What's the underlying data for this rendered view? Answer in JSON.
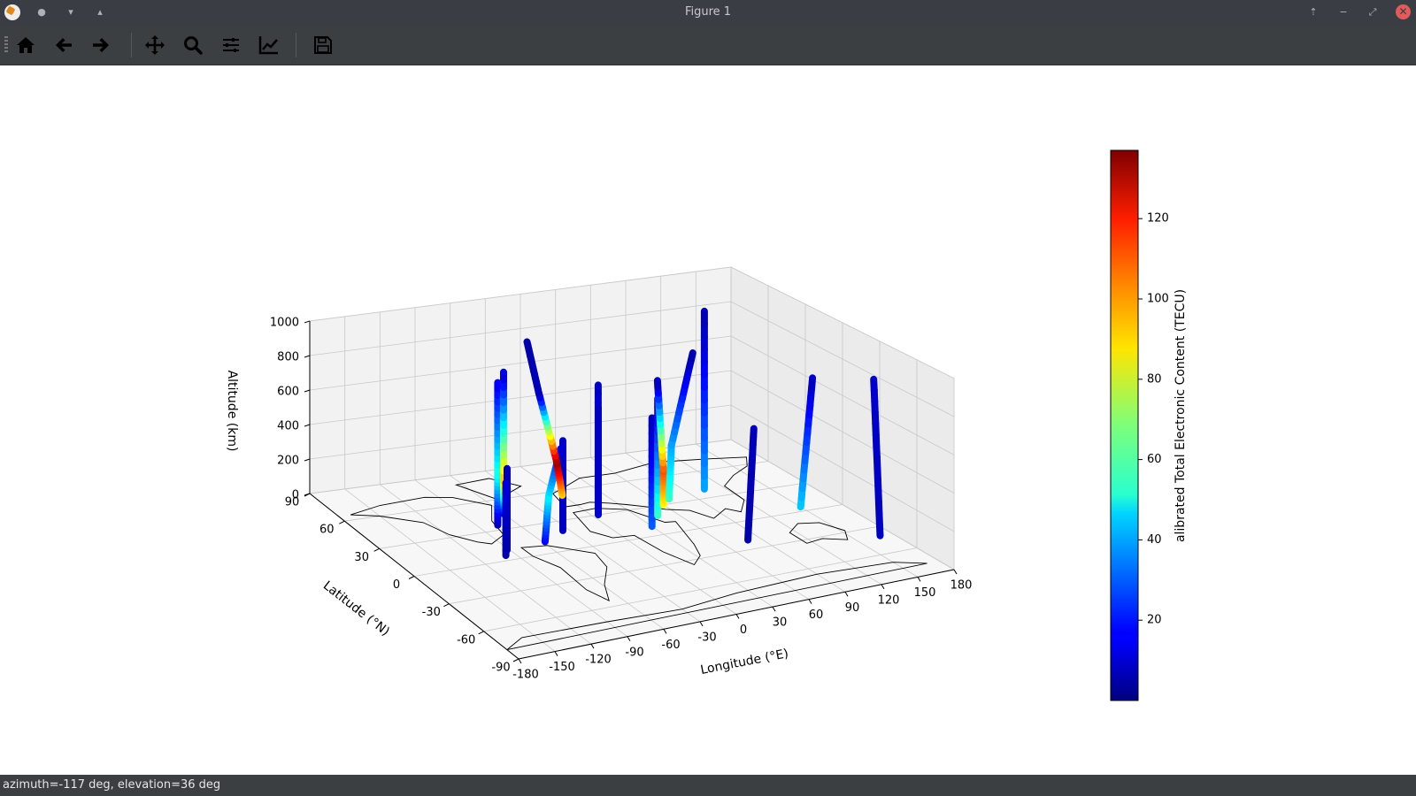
{
  "window": {
    "title": "Figure 1",
    "controls": {
      "dot": "●",
      "down": "▾",
      "up": "▴",
      "pin": "⇡",
      "minimize": "−",
      "restore": "⤢",
      "close": "✕"
    }
  },
  "toolbar": {
    "items": [
      "home-icon",
      "back-arrow-icon",
      "forward-arrow-icon",
      "pan-icon",
      "zoom-icon",
      "subplots-icon",
      "customize-icon",
      "save-icon"
    ]
  },
  "status": {
    "text": "azimuth=-117 deg, elevation=36 deg"
  },
  "chart_data": {
    "type": "scatter",
    "colormap": "jet",
    "xlabel": "Longitude (°E)",
    "ylabel": "Latitude (°N)",
    "zlabel": "Altitude (km)",
    "colorbar_label": "alibrated Total Electronic Content (TECU)",
    "xlim": [
      -180,
      180
    ],
    "ylim": [
      -90,
      90
    ],
    "zlim": [
      0,
      1000
    ],
    "xticks": [
      "-180",
      "-150",
      "-120",
      "-90",
      "-60",
      "-30",
      "0",
      "30",
      "60",
      "90",
      "120",
      "150",
      "180"
    ],
    "yticks": [
      "-90",
      "-60",
      "-30",
      "0",
      "30",
      "60",
      "90"
    ],
    "zticks": [
      "0",
      "200",
      "400",
      "600",
      "800",
      "1000"
    ],
    "colorbar_range": [
      0,
      137
    ],
    "colorbar_ticks": [
      "20",
      "40",
      "60",
      "80",
      "100",
      "120"
    ],
    "view": {
      "azimuth": -117,
      "elevation": 36
    },
    "series": [
      {
        "points": [
          {
            "lon": -75,
            "lat": 35,
            "alt": 0,
            "tec": 5
          },
          {
            "lon": -75,
            "lat": 35,
            "alt": 300,
            "tec": 55
          },
          {
            "lon": -75,
            "lat": 35,
            "alt": 800,
            "tec": 15
          }
        ]
      },
      {
        "points": [
          {
            "lon": -60,
            "lat": 45,
            "alt": 0,
            "tec": 10
          },
          {
            "lon": -60,
            "lat": 45,
            "alt": 200,
            "tec": 95
          },
          {
            "lon": -60,
            "lat": 45,
            "alt": 800,
            "tec": 10
          }
        ]
      },
      {
        "points": [
          {
            "lon": -92,
            "lat": 10,
            "alt": 0,
            "tec": 5
          },
          {
            "lon": -92,
            "lat": 10,
            "alt": 450,
            "tec": 8
          }
        ]
      },
      {
        "points": [
          {
            "lon": -98,
            "lat": 5,
            "alt": 0,
            "tec": 5
          },
          {
            "lon": -98,
            "lat": 5,
            "alt": 400,
            "tec": 12
          }
        ]
      },
      {
        "points": [
          {
            "lon": -58,
            "lat": 12,
            "alt": 0,
            "tec": 15
          },
          {
            "lon": -55,
            "lat": 12,
            "alt": 250,
            "tec": 50
          },
          {
            "lon": -45,
            "lat": 12,
            "alt": 500,
            "tec": 15
          }
        ]
      },
      {
        "points": [
          {
            "lon": -35,
            "lat": 20,
            "alt": 0,
            "tec": 8
          },
          {
            "lon": -35,
            "lat": 20,
            "alt": 500,
            "tec": 10
          }
        ]
      },
      {
        "points": [
          {
            "lon": 10,
            "lat": 35,
            "alt": 0,
            "tec": 30
          },
          {
            "lon": 10,
            "lat": 35,
            "alt": 700,
            "tec": 8
          }
        ]
      },
      {
        "points": [
          {
            "lon": 0,
            "lat": 55,
            "alt": 0,
            "tec": 90
          },
          {
            "lon": -5,
            "lat": 55,
            "alt": 200,
            "tec": 135
          },
          {
            "lon": -20,
            "lat": 55,
            "alt": 600,
            "tec": 8
          },
          {
            "lon": -30,
            "lat": 55,
            "alt": 900,
            "tec": 5
          }
        ]
      },
      {
        "points": [
          {
            "lon": 5,
            "lat": 30,
            "alt": 0,
            "tec": 10
          },
          {
            "lon": 5,
            "lat": 30,
            "alt": 600,
            "tec": 8
          }
        ]
      },
      {
        "points": [
          {
            "lon": 30,
            "lat": 10,
            "alt": 0,
            "tec": 30
          },
          {
            "lon": 30,
            "lat": 10,
            "alt": 600,
            "tec": 8
          }
        ]
      },
      {
        "points": [
          {
            "lon": 45,
            "lat": 20,
            "alt": 0,
            "tec": 60
          },
          {
            "lon": 45,
            "lat": 20,
            "alt": 650,
            "tec": 10
          }
        ]
      },
      {
        "points": [
          {
            "lon": 60,
            "lat": 30,
            "alt": 0,
            "tec": 85
          },
          {
            "lon": 60,
            "lat": 30,
            "alt": 200,
            "tec": 110
          },
          {
            "lon": 55,
            "lat": 30,
            "alt": 700,
            "tec": 5
          }
        ]
      },
      {
        "points": [
          {
            "lon": 70,
            "lat": 35,
            "alt": 0,
            "tec": 60
          },
          {
            "lon": 72,
            "lat": 35,
            "alt": 300,
            "tec": 40
          },
          {
            "lon": 90,
            "lat": 35,
            "alt": 800,
            "tec": 5
          }
        ]
      },
      {
        "points": [
          {
            "lon": 105,
            "lat": 40,
            "alt": 0,
            "tec": 40
          },
          {
            "lon": 105,
            "lat": 40,
            "alt": 1000,
            "tec": 5
          }
        ]
      },
      {
        "points": [
          {
            "lon": 80,
            "lat": -20,
            "alt": 0,
            "tec": 5
          },
          {
            "lon": 85,
            "lat": -20,
            "alt": 600,
            "tec": 8
          }
        ]
      },
      {
        "points": [
          {
            "lon": 150,
            "lat": 5,
            "alt": 0,
            "tec": 45
          },
          {
            "lon": 160,
            "lat": 5,
            "alt": 700,
            "tec": 8
          }
        ]
      },
      {
        "points": [
          {
            "lon": 170,
            "lat": -40,
            "alt": 0,
            "tec": 8
          },
          {
            "lon": 175,
            "lat": -30,
            "alt": 800,
            "tec": 10
          }
        ]
      }
    ]
  }
}
